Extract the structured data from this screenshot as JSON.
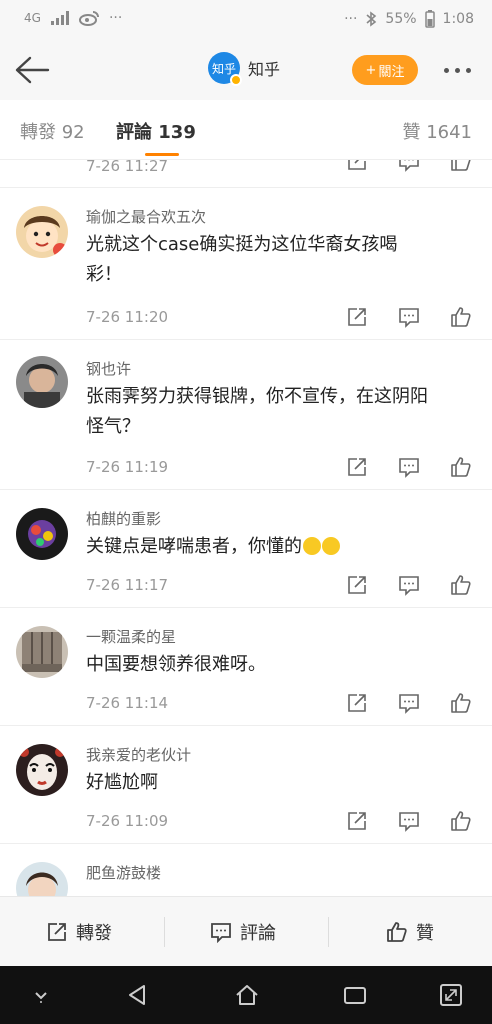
{
  "status_bar": {
    "network": "4G",
    "battery": "55%",
    "time": "1:08",
    "dots": "···"
  },
  "header": {
    "account_name": "知乎",
    "logo_text": "知乎",
    "follow_label": "關注",
    "follow_plus": "+"
  },
  "tabs": {
    "repost_label": "轉發 92",
    "comments_label": "評論 139",
    "likes_label": "贊 1641"
  },
  "partial_comment": {
    "time": "7-26 11:27"
  },
  "comments": [
    {
      "user": "瑜伽之最合欢五次",
      "text_line1": "光就这个case确实挺为这位华裔女孩喝",
      "text_line2": "彩！",
      "time": "7-26 11:20"
    },
    {
      "user": "钢也许",
      "text_line1": "张雨霁努力获得银牌，你不宣传，在这阴阳",
      "text_line2": "怪气？",
      "time": "7-26 11:19"
    },
    {
      "user": "柏麒的重影",
      "text_line1": "关键点是哮喘患者，你懂的",
      "time": "7-26 11:17"
    },
    {
      "user": "一颗温柔的星",
      "text_line1": "中国要想领养很难呀。",
      "time": "7-26 11:14"
    },
    {
      "user": "我亲爱的老伙计",
      "text_line1": "好尴尬啊",
      "time": "7-26 11:09"
    },
    {
      "user": "肥鱼游鼓楼"
    }
  ],
  "bottom_bar": {
    "repost_label": "轉發",
    "comment_label": "評論",
    "like_label": "贊"
  },
  "colors": {
    "accent": "#ff8200",
    "follow_button": "#ff9d1e",
    "brand_blue": "#1e88e5"
  }
}
